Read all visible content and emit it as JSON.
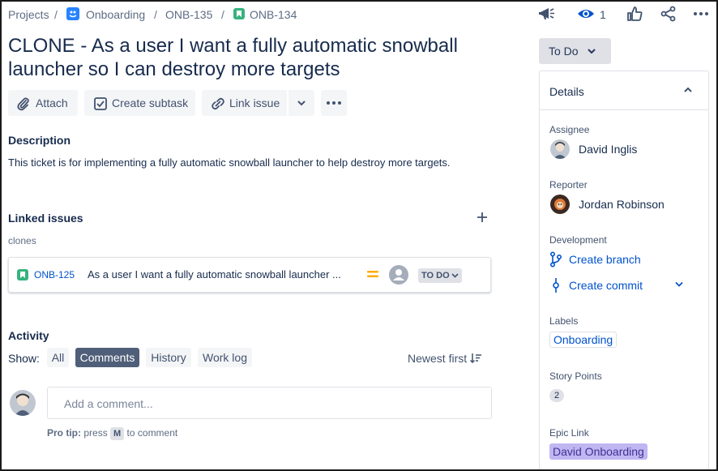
{
  "breadcrumb": {
    "projects": "Projects",
    "project_name": "Onboarding",
    "parent_key": "ONB-135",
    "issue_key": "ONB-134",
    "separator": "/"
  },
  "header_actions": {
    "watch_count": "1"
  },
  "issue": {
    "title": "CLONE - As a user I want a fully automatic snowball launcher so I can destroy more targets"
  },
  "toolbar": {
    "attach_label": "Attach",
    "create_subtask_label": "Create subtask",
    "link_issue_label": "Link issue"
  },
  "description": {
    "heading": "Description",
    "text": "This ticket is for implementing a fully automatic snowball launcher to help destroy more targets."
  },
  "linked_issues": {
    "heading": "Linked issues",
    "relation": "clones",
    "items": [
      {
        "key": "ONB-125",
        "summary": "As a user I want a fully automatic snowball launcher ...",
        "status": "TO DO"
      }
    ]
  },
  "activity": {
    "heading": "Activity",
    "show_label": "Show:",
    "tabs": [
      "All",
      "Comments",
      "History",
      "Work log"
    ],
    "active_tab": "Comments",
    "sort_label": "Newest first",
    "comment_placeholder": "Add a comment...",
    "pro_tip_label": "Pro tip:",
    "pro_tip_press": "press",
    "pro_tip_key": "M",
    "pro_tip_suffix": "to comment"
  },
  "sidebar": {
    "status": "To Do",
    "details_heading": "Details",
    "assignee_label": "Assignee",
    "assignee": "David Inglis",
    "reporter_label": "Reporter",
    "reporter": "Jordan Robinson",
    "development_label": "Development",
    "create_branch": "Create branch",
    "create_commit": "Create commit",
    "labels_label": "Labels",
    "label_value": "Onboarding",
    "story_points_label": "Story Points",
    "story_points": "2",
    "epic_link_label": "Epic Link",
    "epic_link": "David Onboarding"
  },
  "colors": {
    "link": "#0052cc",
    "text": "#172b4d",
    "subtle": "#5e6c84",
    "button_bg": "#f4f5f7",
    "active_tab": "#505f79",
    "story_icon": "#36b37e",
    "project_icon": "#2684ff",
    "priority": "#ffab00",
    "epic_bg": "#c0b6f2"
  },
  "icons": [
    "projects-icon",
    "story-icon",
    "feedback-icon",
    "eye-icon",
    "thumbs-up-icon",
    "share-icon",
    "more-icon",
    "paperclip-icon",
    "checkbox-icon",
    "link-icon",
    "chevron-down-icon",
    "plus-icon",
    "sort-icon",
    "branch-icon",
    "commit-icon",
    "chevron-up-icon"
  ]
}
